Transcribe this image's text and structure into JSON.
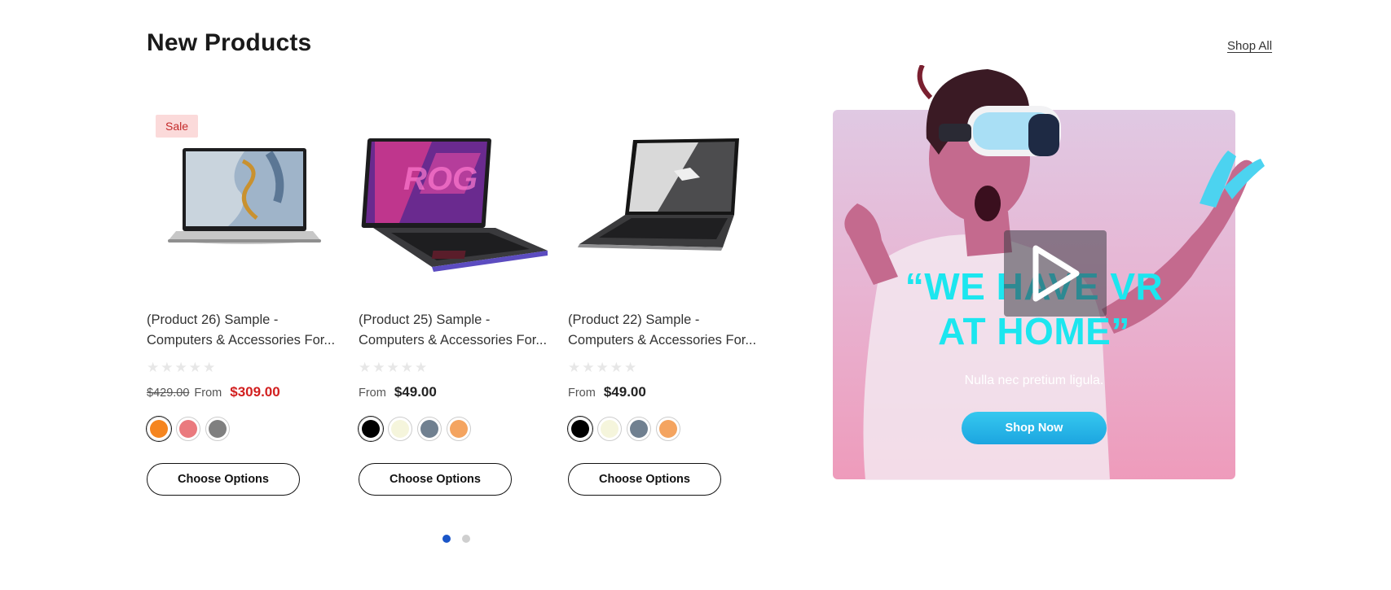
{
  "header": {
    "title": "New Products",
    "shop_all_label": "Shop All"
  },
  "products": [
    {
      "badge": "Sale",
      "title_line1": "(Product 26) Sample -",
      "title_line2": "Computers & Accessories For...",
      "rating": 0,
      "price_compare": "$429.00",
      "price_from_label": "From",
      "price": "$309.00",
      "swatches": [
        "#f5851f",
        "#ea7a7e",
        "#808080"
      ],
      "selected_swatch": 0,
      "button_label": "Choose Options"
    },
    {
      "title_line1": "(Product 25) Sample -",
      "title_line2": "Computers & Accessories For...",
      "rating": 0,
      "price_from_label": "From",
      "price": "$49.00",
      "swatches": [
        "#000000",
        "#f5f5dc",
        "#708090",
        "#f4a460"
      ],
      "selected_swatch": 0,
      "button_label": "Choose Options"
    },
    {
      "title_line1": "(Product 22) Sample -",
      "title_line2": "Computers & Accessories For...",
      "rating": 0,
      "price_from_label": "From",
      "price": "$49.00",
      "swatches": [
        "#000000",
        "#f5f5dc",
        "#708090",
        "#f4a460"
      ],
      "selected_swatch": 0,
      "button_label": "Choose Options"
    }
  ],
  "carousel": {
    "page_count": 2,
    "active_page": 0
  },
  "promo": {
    "headline_line1": "“WE HAVE VR",
    "headline_line2": "AT HOME”",
    "subtitle": "Nulla nec pretium ligula.",
    "button_label": "Shop Now",
    "play_icon": "play-icon",
    "accent_color": "#1ce6ef"
  },
  "colors": {
    "sale_price": "#d21f1f",
    "sale_badge_bg": "#fbdada",
    "dot_active": "#1a55c8"
  }
}
